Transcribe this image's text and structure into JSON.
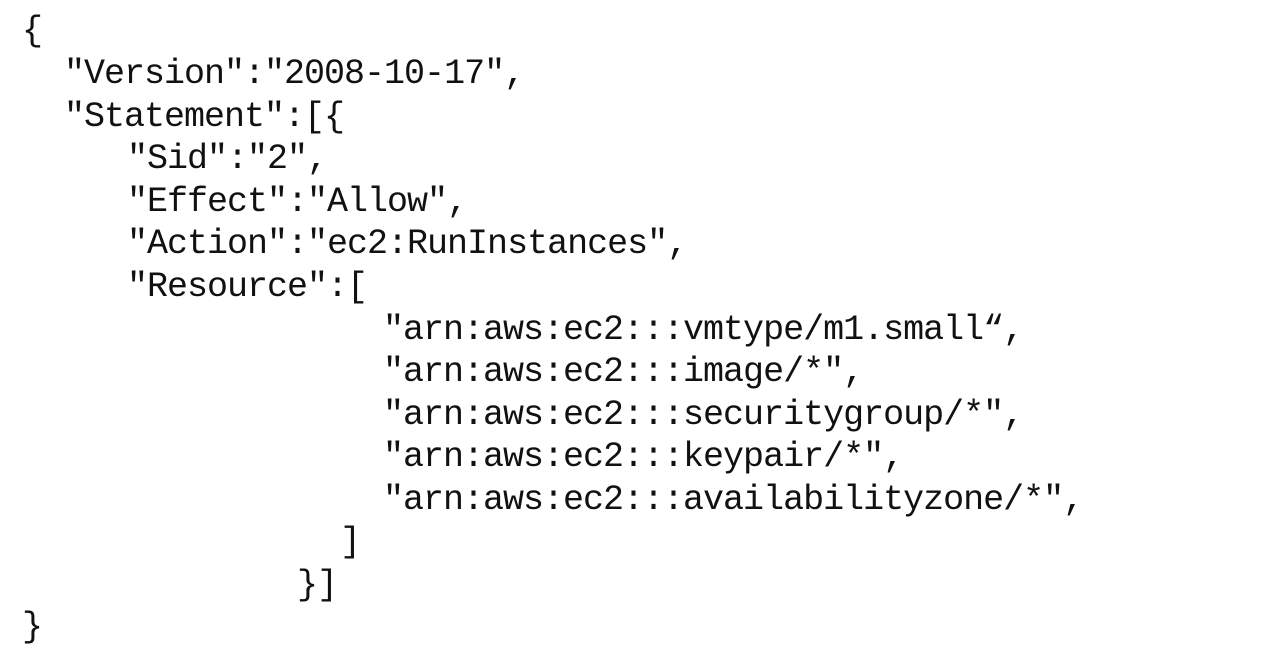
{
  "document": {
    "lines": [
      "{",
      "\"Version\":\"2008-10-17\",",
      "\"Statement\":[{",
      "\"Sid\":\"2\",",
      "\"Effect\":\"Allow\",",
      "\"Action\":\"ec2:RunInstances\",",
      "\"Resource\":[",
      "\"arn:aws:ec2:::vmtype/m1.small“,",
      "\"arn:aws:ec2:::image/*\",",
      "\"arn:aws:ec2:::securitygroup/*\",",
      "\"arn:aws:ec2:::keypair/*\",",
      "\"arn:aws:ec2:::availabilityzone/*\",",
      "]",
      "}]",
      "}"
    ]
  }
}
